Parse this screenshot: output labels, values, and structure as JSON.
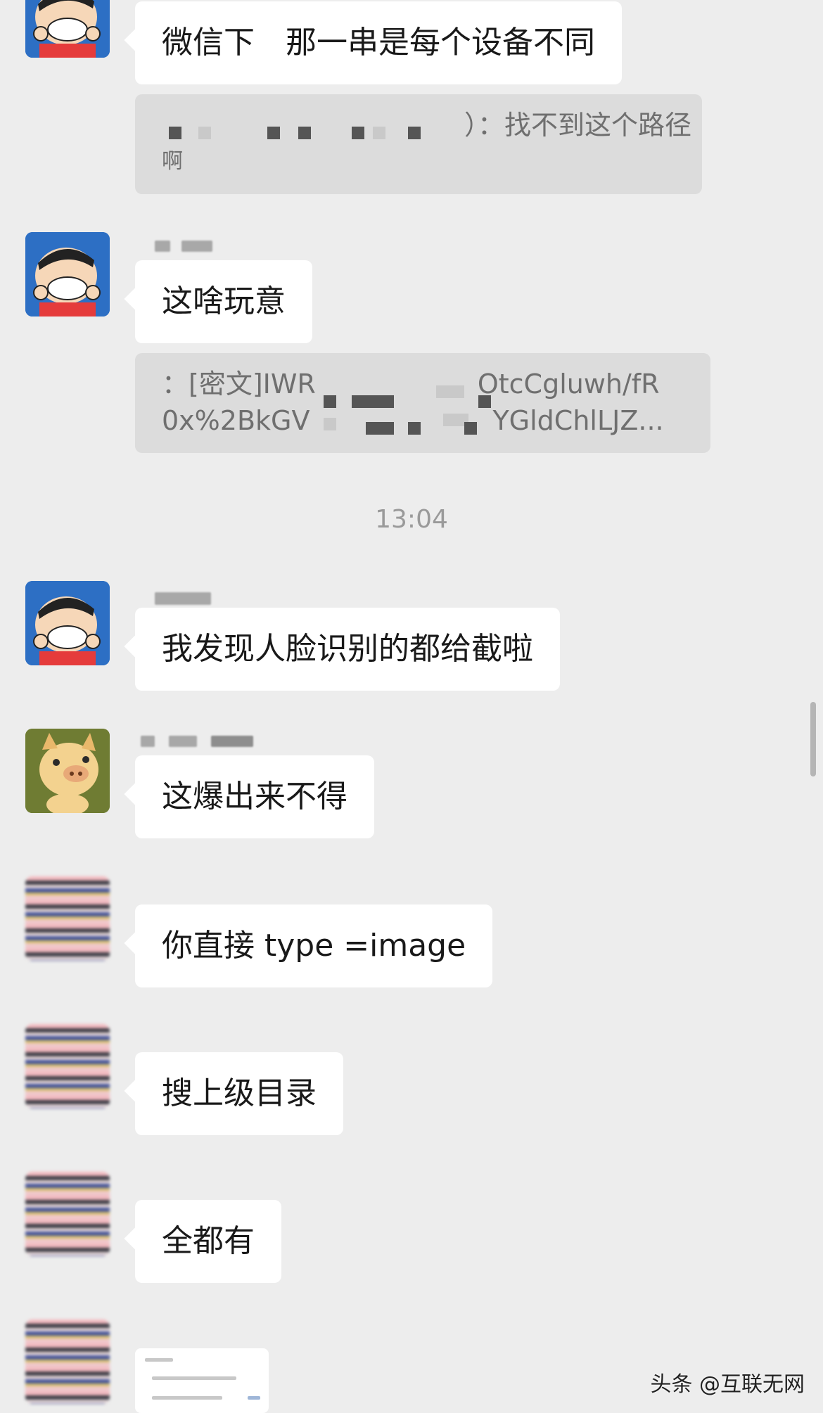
{
  "messages": {
    "m1": "微信下　那一串是每个设备不同",
    "q1_line1": "）：找不到这个路径",
    "q1_line2": "啊",
    "m2": "这啥玩意",
    "q2_line1": "：[密文]IWR",
    "q2_line1_end": "OtcCgluwh/fR",
    "q2_line2": "0x%2BkGV",
    "q2_line2_end": "YGldChlLJZ...",
    "timestamp": "13:04",
    "m3": "我发现人脸识别的都给截啦",
    "m4": "这爆出来不得",
    "m5": "你直接 type =image",
    "m6": "搜上级目录",
    "m7": "全都有"
  },
  "watermark": "头条 @互联无网",
  "colors": {
    "background": "#ededed",
    "bubble": "#ffffff",
    "quote": "#dcdcdc",
    "timestamp": "#9a9a9a"
  }
}
